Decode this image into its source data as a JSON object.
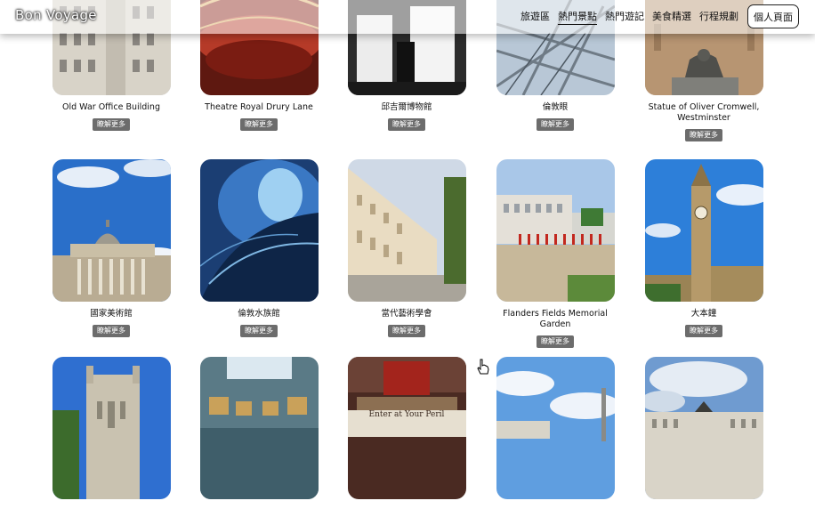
{
  "header": {
    "brand": "Bon Voyage",
    "nav": [
      "旅遊區",
      "熱門景點",
      "熱門遊記",
      "美食精選",
      "行程規劃"
    ],
    "active_nav": "熱門景點",
    "profile_label": "個人頁面"
  },
  "cards": [
    {
      "name": "Old War Office Building",
      "more": "瞭解更多"
    },
    {
      "name": "Theatre Royal Drury Lane",
      "more": "瞭解更多"
    },
    {
      "name": "邱吉爾博物館",
      "more": "瞭解更多"
    },
    {
      "name": "倫敦眼",
      "more": "瞭解更多"
    },
    {
      "name": "Statue of Oliver Cromwell, Westminster",
      "more": "瞭解更多"
    },
    {
      "name": "國家美術館",
      "more": "瞭解更多"
    },
    {
      "name": "倫敦水族館",
      "more": "瞭解更多"
    },
    {
      "name": "當代藝術學會",
      "more": "瞭解更多"
    },
    {
      "name": "Flanders Fields Memorial Garden",
      "more": "瞭解更多"
    },
    {
      "name": "大本鐘",
      "more": "瞭解更多"
    },
    {
      "name": "",
      "more": ""
    },
    {
      "name": "",
      "more": ""
    },
    {
      "name": "",
      "more": ""
    },
    {
      "name": "",
      "more": ""
    },
    {
      "name": "",
      "more": ""
    }
  ],
  "signage": {
    "shop_sign": "Enter at Your Peril"
  }
}
